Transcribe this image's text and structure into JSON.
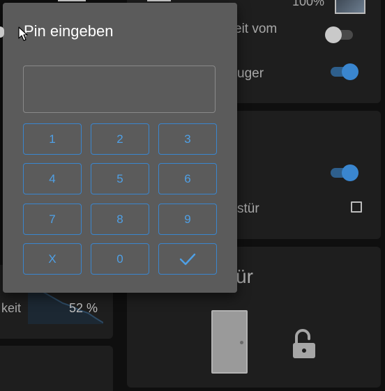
{
  "background": {
    "top_left_label": "",
    "top_value": "100%",
    "row1_label_partial": "eit vom",
    "row2_label_partial": "uger",
    "row3_label_partial": "stür",
    "door_title_partial": "ür",
    "humidity_label_partial": "keit",
    "humidity_value": "52 %"
  },
  "dialog": {
    "title": "Pin eingeben",
    "pin_value": "",
    "keys": [
      "1",
      "2",
      "3",
      "4",
      "5",
      "6",
      "7",
      "8",
      "9",
      "X",
      "0",
      "✓"
    ]
  },
  "toggles": {
    "row1": "off",
    "row2": "on",
    "row3": "on"
  },
  "colors": {
    "accent": "#3a86cf",
    "dialog_bg": "#5b5b5b",
    "card_bg": "#1e1e1e"
  },
  "icons": {
    "door": "door-icon",
    "lock": "lock-open-icon",
    "checkmark": "check-icon",
    "cursor": "mouse-cursor-icon"
  }
}
